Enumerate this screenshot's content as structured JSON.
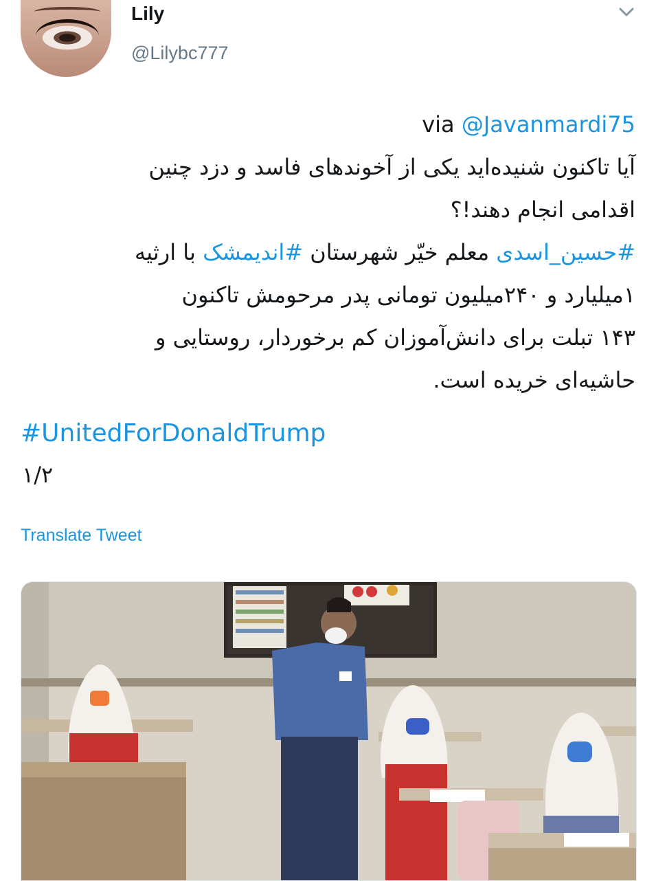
{
  "author": {
    "display_name": "Lily",
    "handle": "@Lilybc777"
  },
  "icons": {
    "menu": "chevron-down-icon"
  },
  "tweet": {
    "via_prefix": "via ",
    "via_handle": "@Javanmardi75",
    "line1": "آیا تاکنون شنیده‌اید یکی از آخوندهای فاسد و دزد چنین",
    "line2": "اقدامی انجام دهند!؟",
    "line3_hashtag1": "#حسین_اسدی",
    "line3_mid": " معلم خیّر شهرستان ",
    "line3_hashtag2": "#اندیمشک",
    "line3_end": " با ارثیه",
    "line4": "۱میلیارد و ۲۴۰میلیون تومانی پدر مرحومش تاکنون",
    "line5": "۱۴۳ تبلت برای دانش‌آموزان کم برخوردار، روستایی و",
    "line6": "حاشیه‌ای خریده است.",
    "hashtag_en": "#UnitedForDonaldTrump",
    "thread_counter": "۱/۲"
  },
  "actions": {
    "translate": "Translate Tweet"
  },
  "colors": {
    "link": "#1b95e0",
    "text": "#14171a",
    "secondary": "#657786"
  }
}
